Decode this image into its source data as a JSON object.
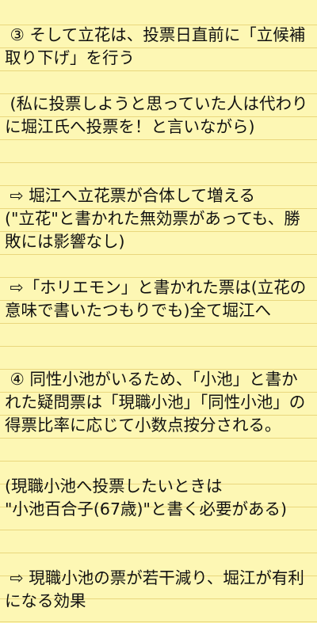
{
  "note": {
    "paragraphs": [
      " ③ そして立花は、投票日直前に「立候補取り下げ」を行う",
      " (私に投票しようと思っていた人は代わりに堀江氏へ投票を！と言いながら)",
      " ⇨ 堀江へ立花票が合体して増える\n(\"立花\"と書かれた無効票があっても、勝敗には影響なし)",
      " ⇨「ホリエモン」と書かれた票は(立花の意味で書いたつもりでも)全て堀江へ",
      " ④ 同性小池がいるため、「小池」と書かれた疑問票は「現職小池」「同性小池」の得票比率に応じて小数点按分される。",
      "(現職小池へ投票したいときは\n\"小池百合子(67歳)\"と書く必要がある)",
      " ⇨ 現職小池の票が若干減り、堀江が有利になる効果"
    ],
    "colors": {
      "paper": "#fdf7b4",
      "rule": "#e9d77d",
      "text": "#111111"
    }
  }
}
